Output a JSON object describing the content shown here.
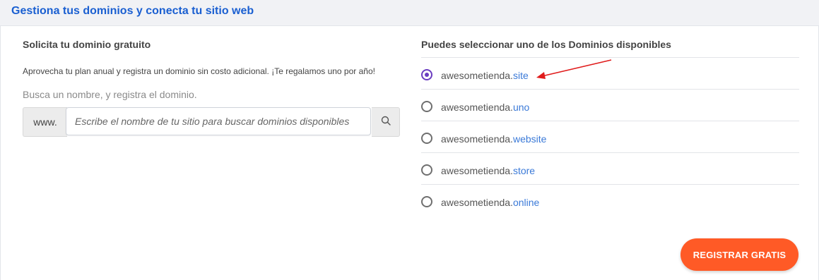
{
  "header": {
    "title": "Gestiona tus dominios y conecta tu sitio web"
  },
  "left": {
    "title": "Solicita tu dominio gratuito",
    "description": "Aprovecha tu plan anual y registra un dominio sin costo adicional. ¡Te regalamos uno por año!",
    "hint": "Busca un nombre, y registra el dominio.",
    "prefix": "www.",
    "search_placeholder": "Escribe el nombre de tu sitio para buscar dominios disponibles",
    "search_value": "",
    "search_icon": "search-icon"
  },
  "right": {
    "title": "Puedes seleccionar uno de los Dominios disponibles",
    "domains": [
      {
        "name": "awesometienda.",
        "tld": "site",
        "selected": true
      },
      {
        "name": "awesometienda.",
        "tld": "uno",
        "selected": false
      },
      {
        "name": "awesometienda.",
        "tld": "website",
        "selected": false
      },
      {
        "name": "awesometienda.",
        "tld": "store",
        "selected": false
      },
      {
        "name": "awesometienda.",
        "tld": "online",
        "selected": false
      }
    ]
  },
  "register_button": {
    "label": "REGISTRAR GRATIS"
  },
  "colors": {
    "accent": "#ff5a26",
    "title_blue": "#1a5fd1",
    "tld_blue": "#3b7ad8",
    "radio_selected": "#6a3cc0",
    "annotation_arrow": "#e01b1b"
  }
}
